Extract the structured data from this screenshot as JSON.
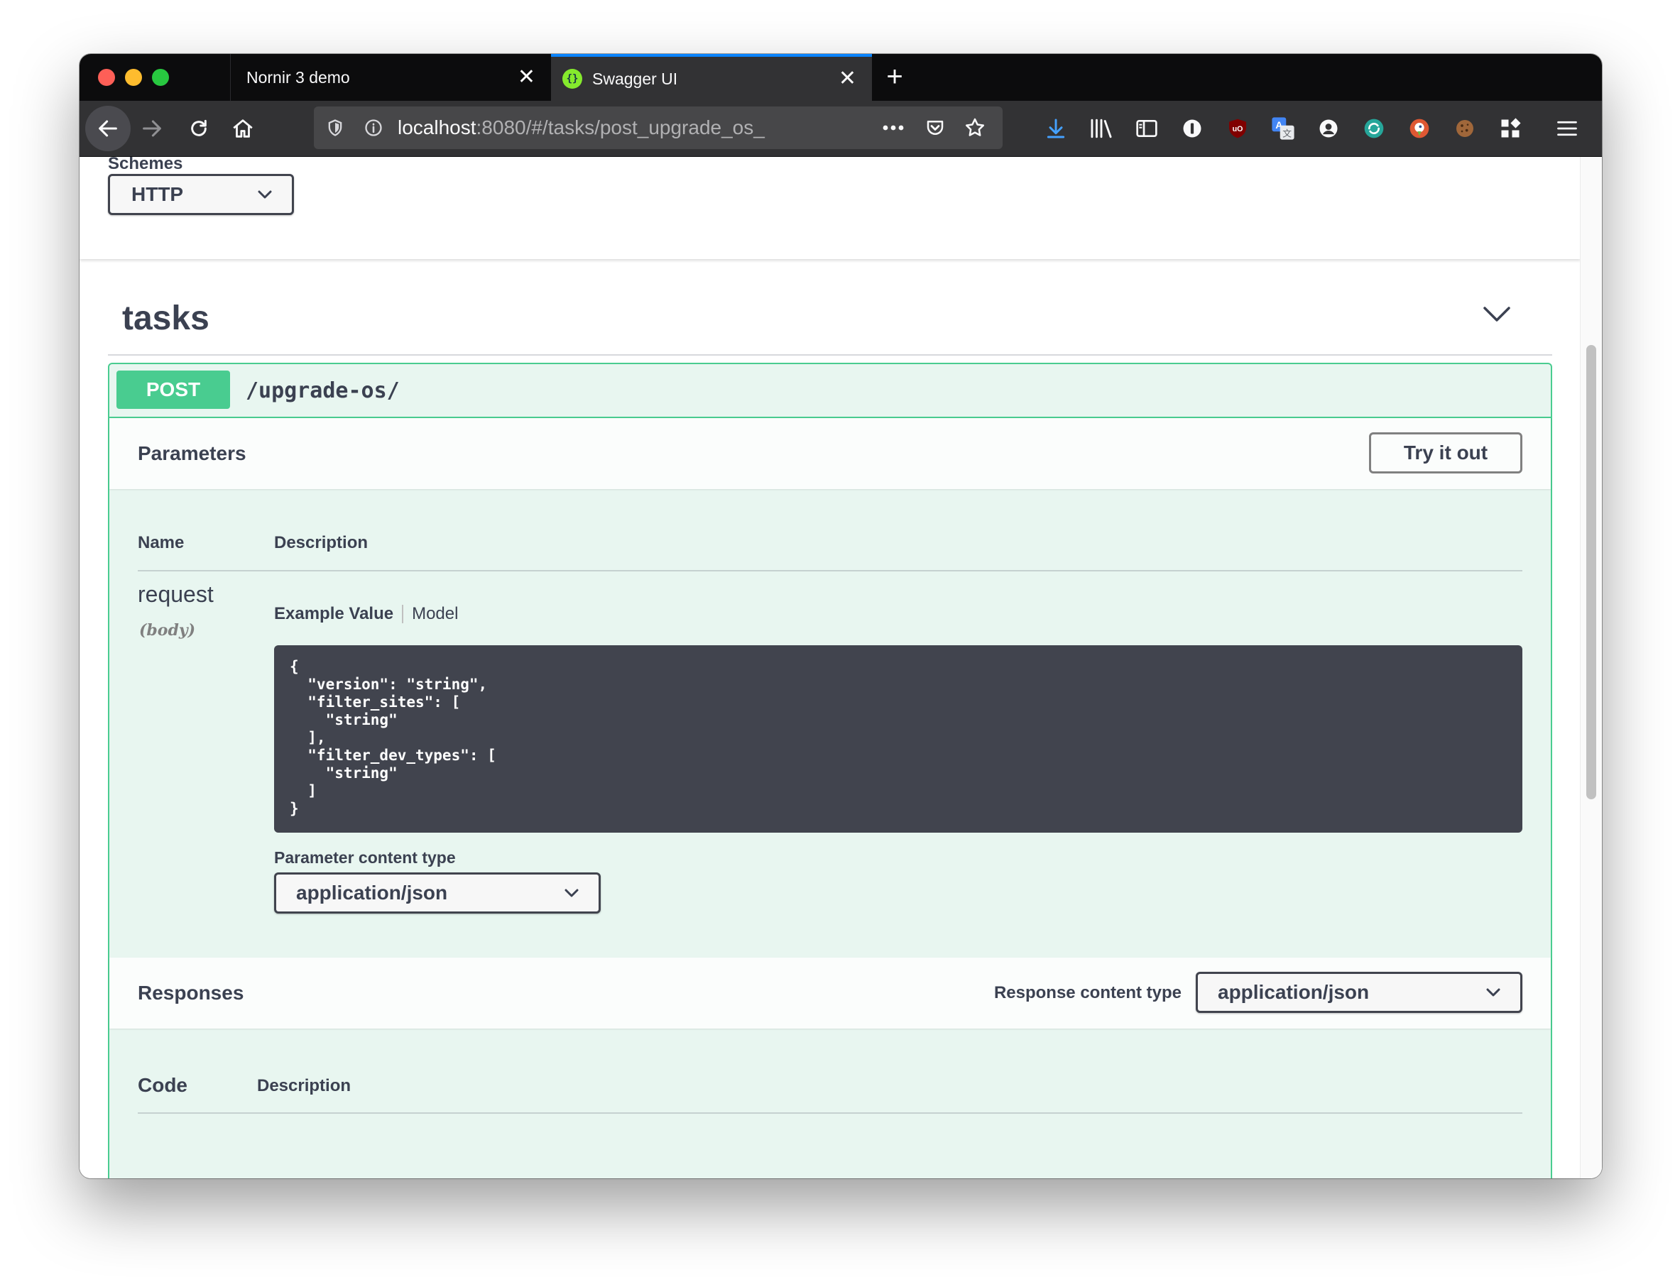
{
  "browser": {
    "tabs": [
      {
        "title": "Nornir 3 demo",
        "active": false
      },
      {
        "title": "Swagger UI",
        "active": true
      }
    ],
    "url": {
      "host": "localhost",
      "rest": ":8080/#/tasks/post_upgrade_os_"
    },
    "colors": {
      "tab_accent": "#0a84ff",
      "window_frame": "#0c0c0d"
    }
  },
  "schemes": {
    "label": "Schemes",
    "selected": "HTTP"
  },
  "tag": {
    "name": "tasks"
  },
  "operation": {
    "method": "POST",
    "path": "/upgrade-os/",
    "colors": {
      "method": "#49cc90",
      "background": "#e8f6f0"
    }
  },
  "parameters": {
    "title": "Parameters",
    "try_label": "Try it out",
    "columns": {
      "name": "Name",
      "description": "Description"
    },
    "items": [
      {
        "name": "request",
        "in": "(body)",
        "example_tab": "Example Value",
        "model_tab": "Model",
        "example": "{\n  \"version\": \"string\",\n  \"filter_sites\": [\n    \"string\"\n  ],\n  \"filter_dev_types\": [\n    \"string\"\n  ]\n}",
        "content_type_label": "Parameter content type",
        "content_type": "application/json"
      }
    ]
  },
  "responses": {
    "title": "Responses",
    "content_type_label": "Response content type",
    "content_type": "application/json",
    "columns": {
      "code": "Code",
      "description": "Description"
    }
  }
}
